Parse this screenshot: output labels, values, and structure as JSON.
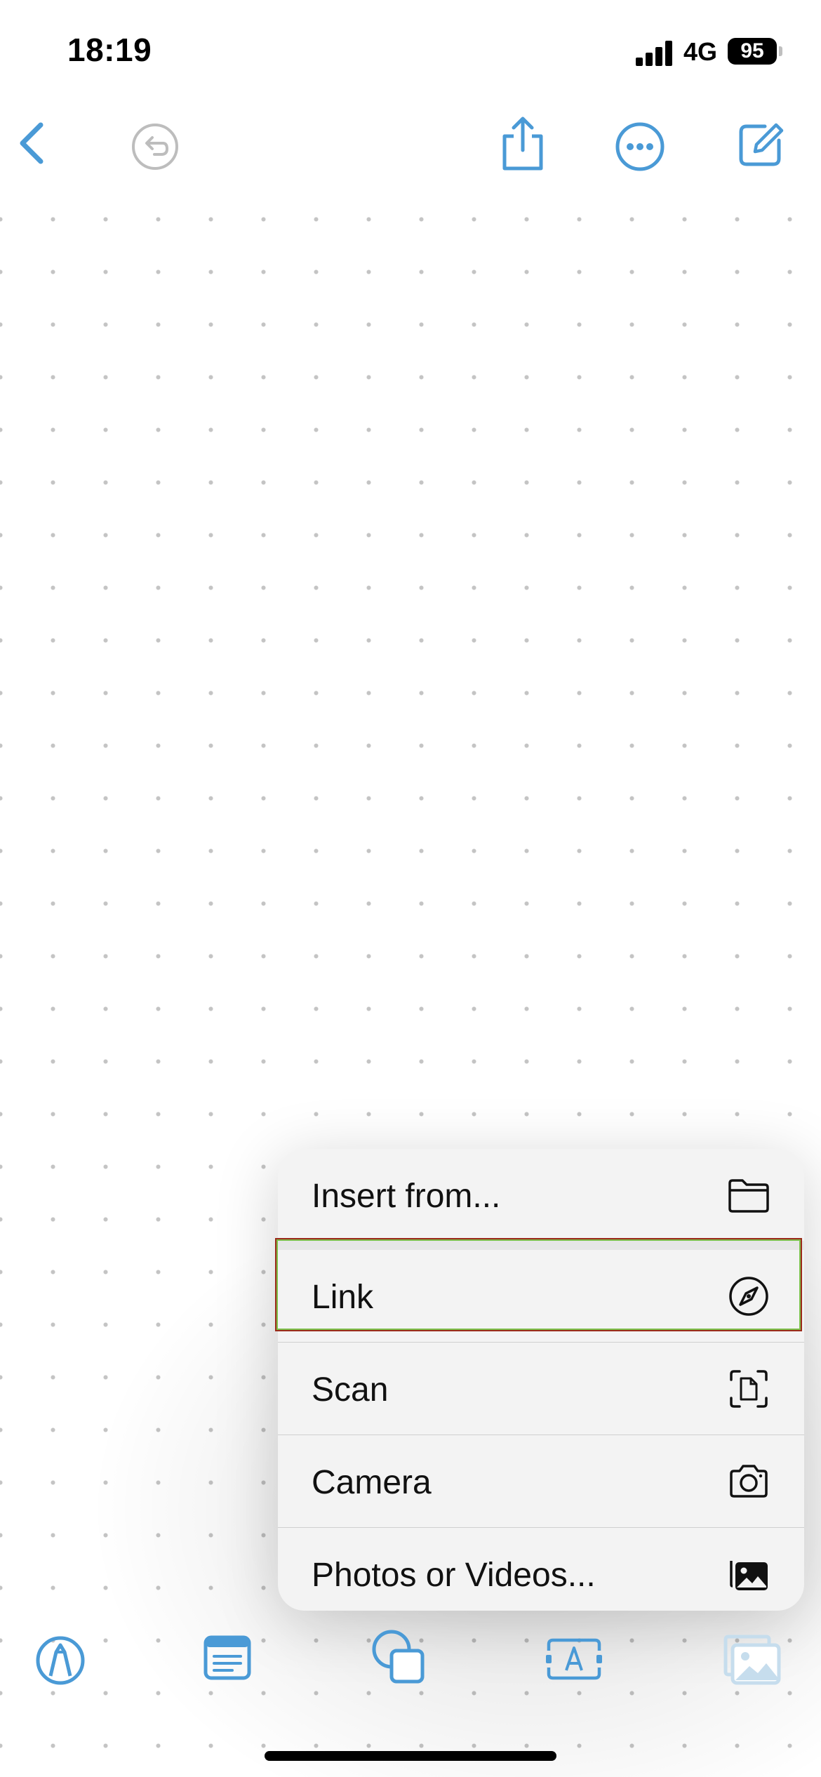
{
  "status_bar": {
    "time": "18:19",
    "network": "4G",
    "battery": "95"
  },
  "colors": {
    "accent": "#4a9ad6",
    "disabled": "#bdbdbd",
    "menu_background": "#f3f3f3"
  },
  "top_toolbar": {
    "back_icon": "chevron-left-icon",
    "undo_icon": "undo-icon",
    "share_icon": "share-icon",
    "more_icon": "ellipsis-circle-icon",
    "new_board_icon": "compose-icon"
  },
  "insert_menu": {
    "items": [
      {
        "label": "Insert from...",
        "icon": "folder-icon"
      },
      {
        "label": "Link",
        "icon": "compass-icon"
      },
      {
        "label": "Scan",
        "icon": "document-scan-icon"
      },
      {
        "label": "Camera",
        "icon": "camera-icon"
      },
      {
        "label": "Photos or Videos...",
        "icon": "photos-icon"
      }
    ]
  },
  "bottom_toolbar": {
    "items": [
      "pen-icon",
      "sticky-note-icon",
      "shapes-icon",
      "text-box-icon",
      "media-icon"
    ]
  }
}
